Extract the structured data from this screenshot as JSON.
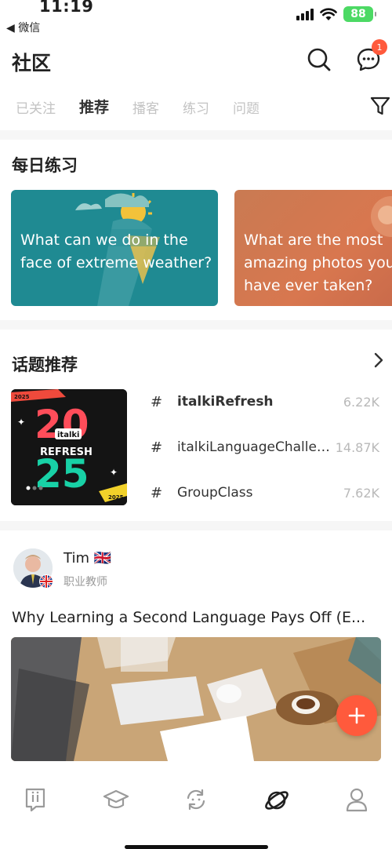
{
  "status_bar": {
    "time": "11:19",
    "back_app": "◀ 微信",
    "battery": "88"
  },
  "header": {
    "title": "社区",
    "message_badge": "1"
  },
  "tabs": [
    {
      "label": "已关注",
      "active": false
    },
    {
      "label": "推荐",
      "active": true
    },
    {
      "label": "播客",
      "active": false
    },
    {
      "label": "练习",
      "active": false
    },
    {
      "label": "问题",
      "active": false
    }
  ],
  "daily_practice": {
    "title": "每日练习",
    "cards": [
      {
        "text": "What can we do in the face of extreme weather?",
        "color": "#1f8a92"
      },
      {
        "text": "What are the most amazing photos you have ever taken?",
        "color": "#d27a52"
      }
    ]
  },
  "topics": {
    "title": "话题推荐",
    "thumbnail": {
      "year_top": "20",
      "year_bottom": "25",
      "brand": "italki",
      "label": "REFRESH",
      "strip": "2025"
    },
    "items": [
      {
        "hash": "#",
        "name": "italkiRefresh",
        "count": "6.22K"
      },
      {
        "hash": "#",
        "name": "italkiLanguageChallen...",
        "count": "14.87K"
      },
      {
        "hash": "#",
        "name": "GroupClass",
        "count": "7.62K"
      }
    ]
  },
  "post": {
    "author_name": "Tim 🇬🇧",
    "author_role": "职业教师",
    "title": "Why Learning a Second Language Pays Off (E..."
  },
  "colors": {
    "accent": "#ff5a3c",
    "battery": "#4cd964"
  },
  "icons": {
    "search": "search-icon",
    "messages": "chat-bubble-icon",
    "filter": "filter-icon",
    "chevron": "chevron-right-icon",
    "add": "plus-icon",
    "nav": [
      "italki-home-icon",
      "graduation-cap-icon",
      "practice-refresh-icon",
      "planet-community-icon",
      "profile-icon"
    ]
  }
}
